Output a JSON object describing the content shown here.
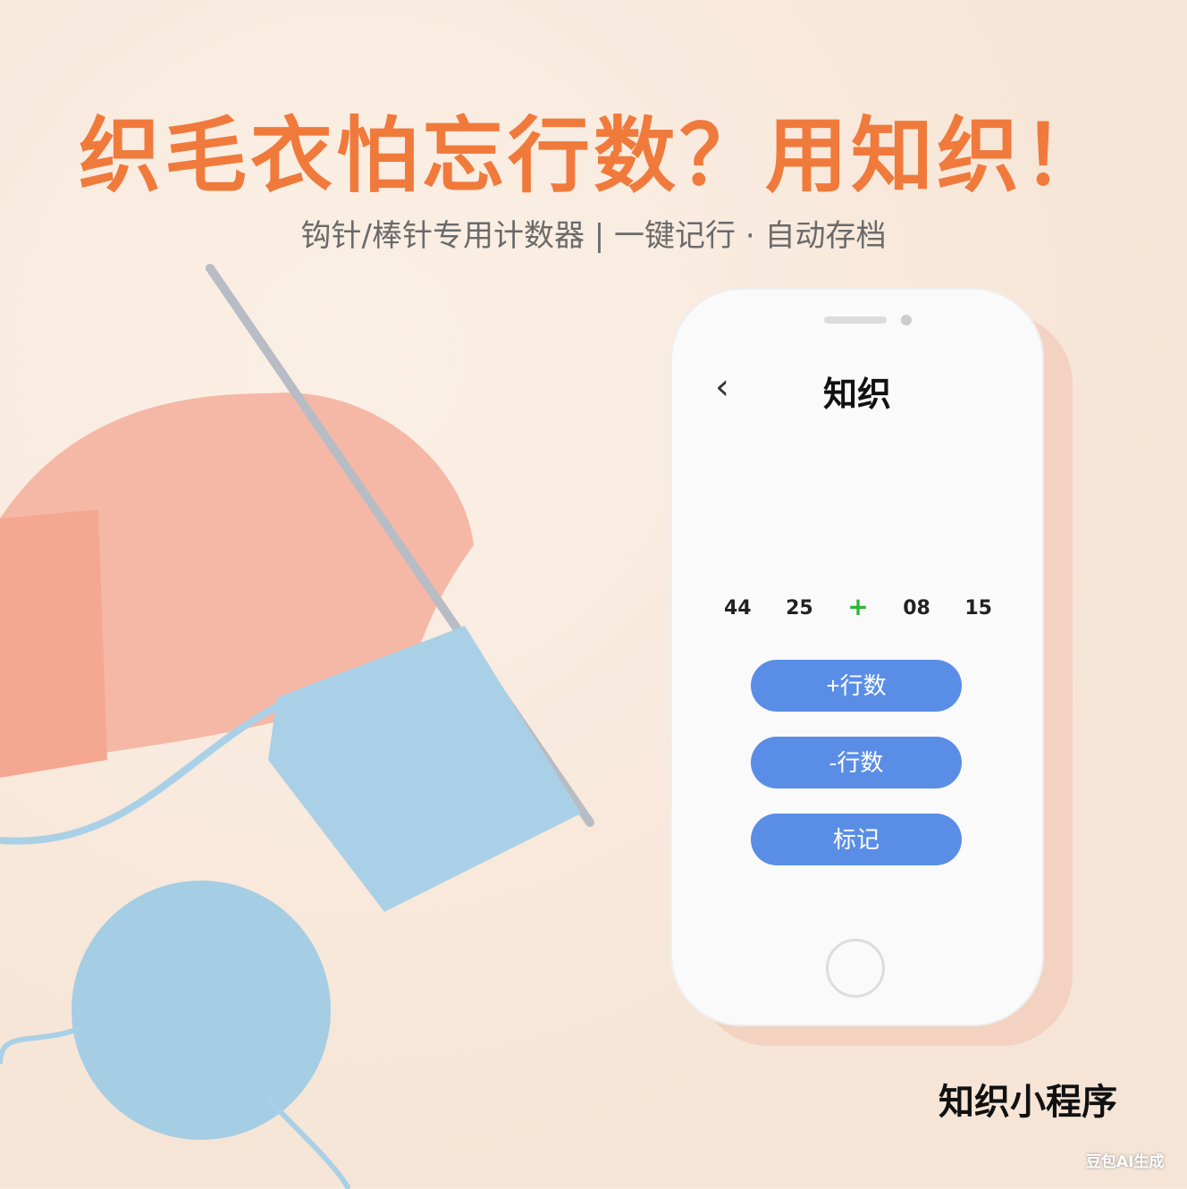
{
  "headline": "织毛衣怕忘行数？用知织！",
  "subtitle": "钩针/棒针专用计数器 | 一键记行 · 自动存档",
  "phone": {
    "back_icon": "chevron-left-icon",
    "title": "知织",
    "counters": [
      "44",
      "25",
      "+",
      "08",
      "15"
    ],
    "buttons": {
      "add_row": "+行数",
      "sub_row": "-行数",
      "mark": "标记"
    }
  },
  "footer_label": "知织小程序",
  "watermark": "豆包AI生成",
  "colors": {
    "headline": "#f07a3c",
    "button": "#5a8ee6",
    "plus": "#2db634"
  }
}
